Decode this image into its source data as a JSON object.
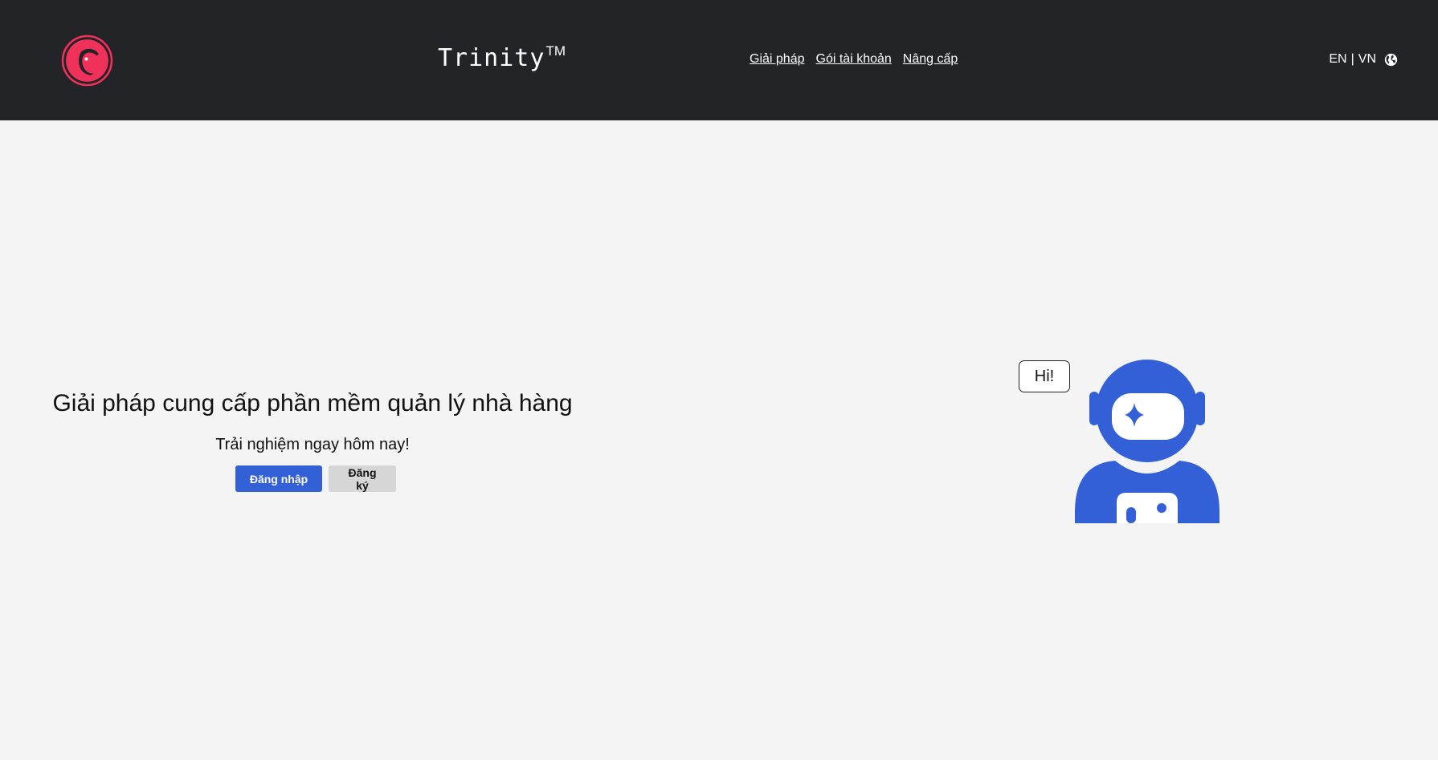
{
  "header": {
    "brand_name": "Trinity",
    "brand_mark": "TM",
    "nav": [
      {
        "label": "Giải pháp"
      },
      {
        "label": "Gói tài khoản"
      },
      {
        "label": "Nâng cấp"
      }
    ],
    "lang": {
      "en": "EN",
      "separator": "|",
      "vn": "VN",
      "icon": "globe-icon"
    },
    "logo_icon": "trinity-logo-icon",
    "colors": {
      "background": "#232428",
      "logo": "#f0315a"
    }
  },
  "hero": {
    "title": "Giải pháp cung cấp phần mềm quản lý nhà hàng",
    "subtitle": "Trải nghiệm ngay hôm nay!",
    "login_label": "Đăng nhập",
    "register_label": "Đăng ký"
  },
  "illustration": {
    "speech_text": "Hi!",
    "icon": "astronaut-icon",
    "color": "#3360d6"
  }
}
